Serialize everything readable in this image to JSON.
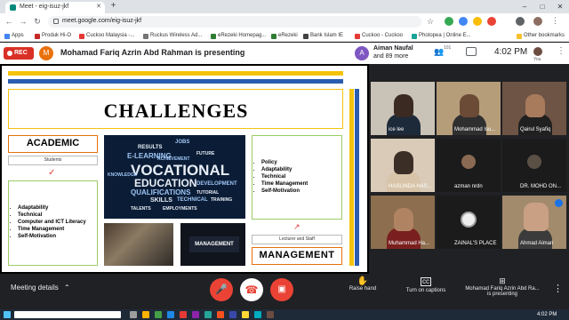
{
  "browser": {
    "tab_title": "Meet - eig-isuz-jkf",
    "url": "meet.google.com/eig-isuz-jkf",
    "bookmarks": [
      "Apps",
      "Produk Hi-O",
      "Cuckoo Malaysia -...",
      "Ruckus Wireless Ad...",
      "eRezeki Homepag...",
      "eRezeki",
      "Bank Islam IE",
      "Cuckoo - Cuckoo",
      "Photopea | Online E...",
      "Other bookmarks"
    ]
  },
  "meet": {
    "rec_label": "REC",
    "presenter_initial": "M",
    "presenting_text": "Mohamad Fariq Azrin Abd Rahman is presenting",
    "participant_initial": "A",
    "participant_name": "Aiman Naufal",
    "participant_more": "and 89 more",
    "people_count": "101",
    "time": "4:02 PM",
    "you_label": "You"
  },
  "slide": {
    "title": "CHALLENGES",
    "academic_heading": "ACADEMIC",
    "students_label": "Students",
    "academic_items": [
      "Adaptability",
      "Technical",
      "Computer and ICT Literacy",
      "Time Management",
      "Self-Motivation"
    ],
    "management_items": [
      "Policy",
      "Adaptability",
      "Technical",
      "Time Management",
      "Self-Motivation"
    ],
    "staff_label": "Lecturer and Staff",
    "management_heading": "MANAGEMENT",
    "photo_badge": "MANAGEMENT",
    "wordcloud": [
      "VOCATIONAL",
      "EDUCATION",
      "E-LEARNING",
      "QUALIFICATIONS",
      "SKILLS",
      "TECHNICAL",
      "TRAINING",
      "RESULTS",
      "JOBS",
      "FUTURE",
      "DEVELOPMENT",
      "TUTORIAL",
      "TALENTS",
      "ACHIEVEMENT",
      "EMPLOYMENTS",
      "KNOWLEDGE"
    ]
  },
  "participants": [
    {
      "name": "ice lee"
    },
    {
      "name": "Mohammad Isu..."
    },
    {
      "name": "Qairul Syafiq"
    },
    {
      "name": "HASLINDA HAS..."
    },
    {
      "name": "azman nrdn"
    },
    {
      "name": "DR. MOHD ON..."
    },
    {
      "name": "Muhammad Ha..."
    },
    {
      "name": "ZAINAL'S PLACE"
    },
    {
      "name": "Ahmad Aiman"
    }
  ],
  "controls": {
    "meeting_details": "Meeting details",
    "raise_hand": "Raise hand",
    "captions": "Turn on captions",
    "presenting_line1": "Mohamad Fariq Azrin Abd Ra...",
    "presenting_line2": "is presenting"
  },
  "taskbar": {
    "time": "4:02 PM"
  },
  "colors": {
    "rec_red": "#d93025",
    "hangup_red": "#ea4335",
    "slide_gold": "#f4c20d",
    "slide_blue": "#2a5db0",
    "slide_orange": "#e8710a"
  }
}
